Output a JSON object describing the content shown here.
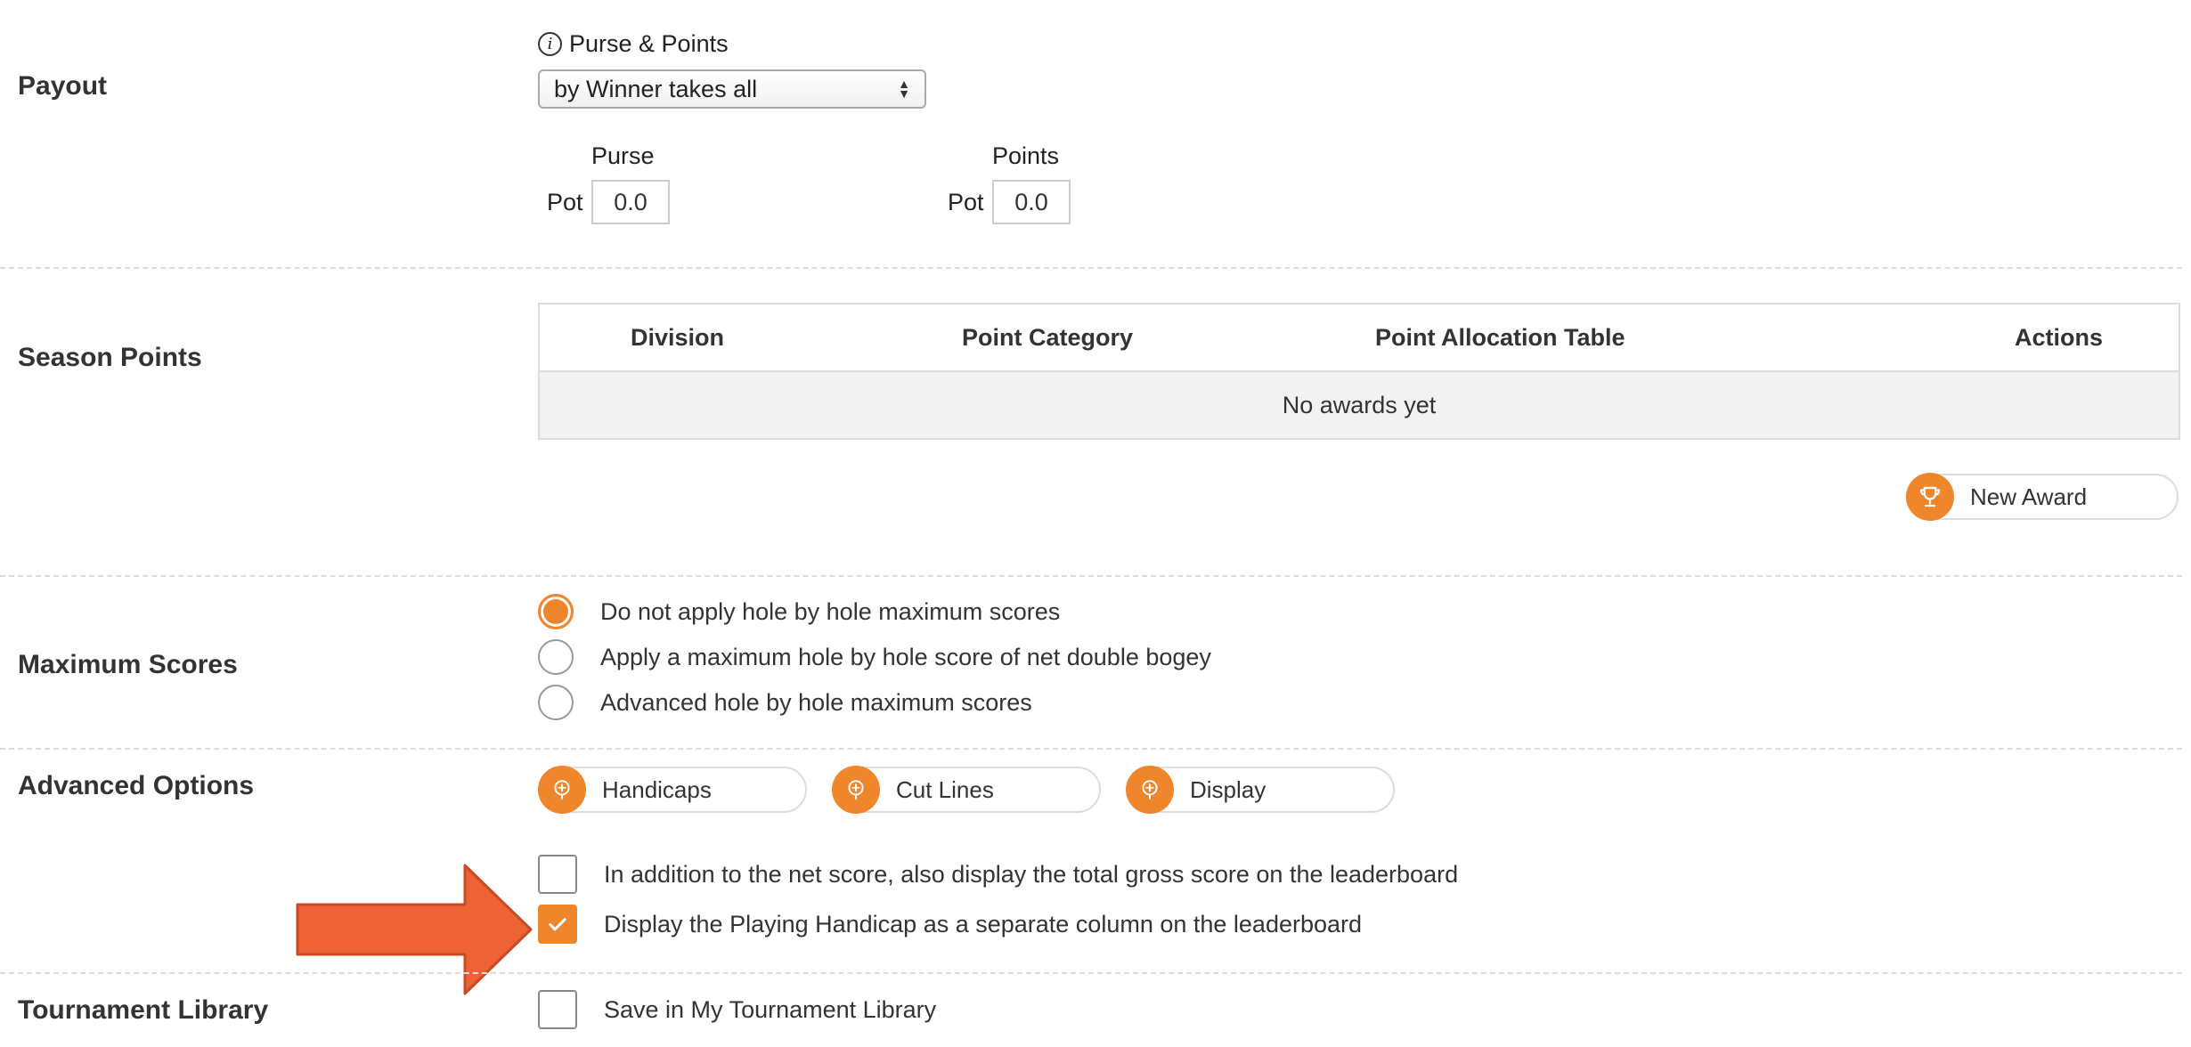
{
  "payout": {
    "section_label": "Payout",
    "info_label": "Purse & Points",
    "select_value": "by Winner takes all",
    "purse_header": "Purse",
    "points_header": "Points",
    "purse_pot_label": "Pot",
    "purse_pot_value": "0.0",
    "points_pot_label": "Pot",
    "points_pot_value": "0.0"
  },
  "season_points": {
    "section_label": "Season Points",
    "columns": [
      "Division",
      "Point Category",
      "Point Allocation Table",
      "Actions"
    ],
    "empty_message": "No awards yet",
    "new_award_label": "New Award"
  },
  "maximum_scores": {
    "section_label": "Maximum Scores",
    "options": [
      {
        "label": "Do not apply hole by hole maximum scores",
        "selected": true
      },
      {
        "label": "Apply a maximum hole by hole score of net double bogey",
        "selected": false
      },
      {
        "label": "Advanced hole by hole maximum scores",
        "selected": false
      }
    ]
  },
  "advanced_options": {
    "section_label": "Advanced Options",
    "buttons": [
      "Handicaps",
      "Cut Lines",
      "Display"
    ],
    "checkboxes": [
      {
        "label": "In addition to the net score, also display the total gross score on the leaderboard",
        "checked": false
      },
      {
        "label": "Display the Playing Handicap as a separate column on the leaderboard",
        "checked": true
      }
    ]
  },
  "tournament_library": {
    "section_label": "Tournament Library",
    "checkbox_label": "Save in My Tournament Library",
    "checked": false
  },
  "colors": {
    "accent": "#f0862c",
    "arrow": "#ee6335",
    "divider": "#dddddd"
  },
  "icons": {
    "info": "info-circle-icon",
    "select_arrows": "updown-arrows-icon",
    "new_award": "trophy-icon",
    "advanced_buttons": "plus-circle-icon",
    "check": "checkmark-icon",
    "annotation": "right-arrow-annotation"
  }
}
